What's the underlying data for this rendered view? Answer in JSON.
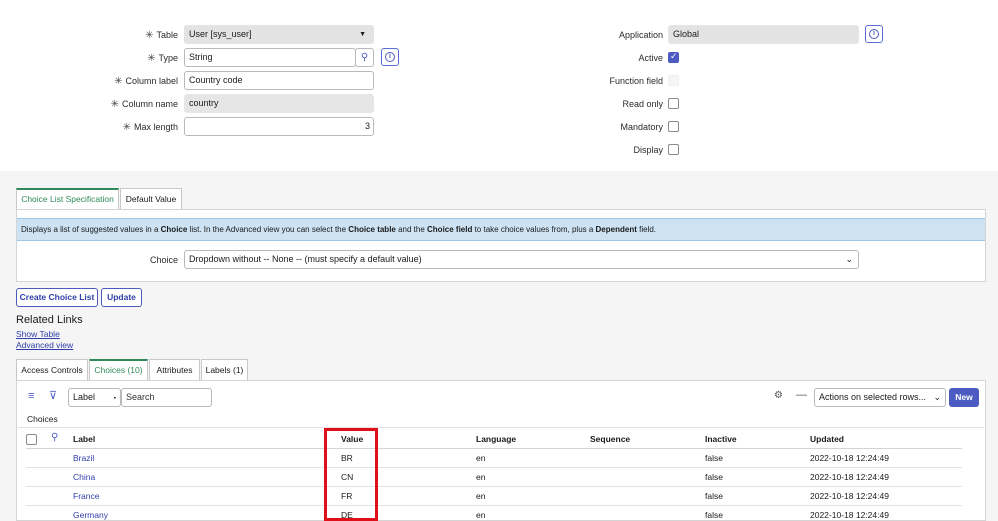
{
  "form": {
    "table": {
      "label": "Table",
      "value": "User [sys_user]"
    },
    "type": {
      "label": "Type",
      "value": "String"
    },
    "column_label": {
      "label": "Column label",
      "value": "Country code"
    },
    "column_name": {
      "label": "Column name",
      "value": "country"
    },
    "max_length": {
      "label": "Max length",
      "value": "3"
    },
    "application": {
      "label": "Application",
      "value": "Global"
    },
    "active": {
      "label": "Active",
      "checked": true
    },
    "function_field": {
      "label": "Function field"
    },
    "read_only": {
      "label": "Read only",
      "checked": false
    },
    "mandatory": {
      "label": "Mandatory",
      "checked": false
    },
    "display": {
      "label": "Display",
      "checked": false
    }
  },
  "section_tabs": [
    "Choice List Specification",
    "Default Value"
  ],
  "info": {
    "t1": "Displays a list of suggested values in a ",
    "b1": "Choice",
    "t2": " list. In the Advanced view you can select the ",
    "b2": "Choice table",
    "t3": " and the ",
    "b3": "Choice field",
    "t4": " to take choice values from, plus a ",
    "b4": "Dependent",
    "t5": " field."
  },
  "choice": {
    "label": "Choice",
    "value": "Dropdown without -- None -- (must specify a default value)"
  },
  "buttons": {
    "create_choice_list": "Create Choice List",
    "update": "Update",
    "new": "New"
  },
  "related_links": {
    "title": "Related Links",
    "show_table": "Show Table",
    "advanced_view": "Advanced view"
  },
  "related_tabs": [
    "Access Controls",
    "Choices (10)",
    "Attributes",
    "Labels (1)"
  ],
  "list": {
    "filter_field": "Label",
    "search_placeholder": "Search",
    "actions": "Actions on selected rows...",
    "title": "Choices",
    "columns": [
      "Label",
      "Value",
      "Language",
      "Sequence",
      "Inactive",
      "Updated"
    ],
    "rows": [
      {
        "label": "Brazil",
        "value": "BR",
        "language": "en",
        "sequence": "",
        "inactive": "false",
        "updated": "2022-10-18 12:24:49"
      },
      {
        "label": "China",
        "value": "CN",
        "language": "en",
        "sequence": "",
        "inactive": "false",
        "updated": "2022-10-18 12:24:49"
      },
      {
        "label": "France",
        "value": "FR",
        "language": "en",
        "sequence": "",
        "inactive": "false",
        "updated": "2022-10-18 12:24:49"
      },
      {
        "label": "Germany",
        "value": "DE",
        "language": "en",
        "sequence": "",
        "inactive": "false",
        "updated": "2022-10-18 12:24:49"
      }
    ]
  },
  "colors": {
    "accent": "#4c5bc1",
    "link": "#2f3ea8",
    "tab_active": "#2e8a5a",
    "info_bg": "#cde3f3",
    "highlight": "#e0101a"
  }
}
